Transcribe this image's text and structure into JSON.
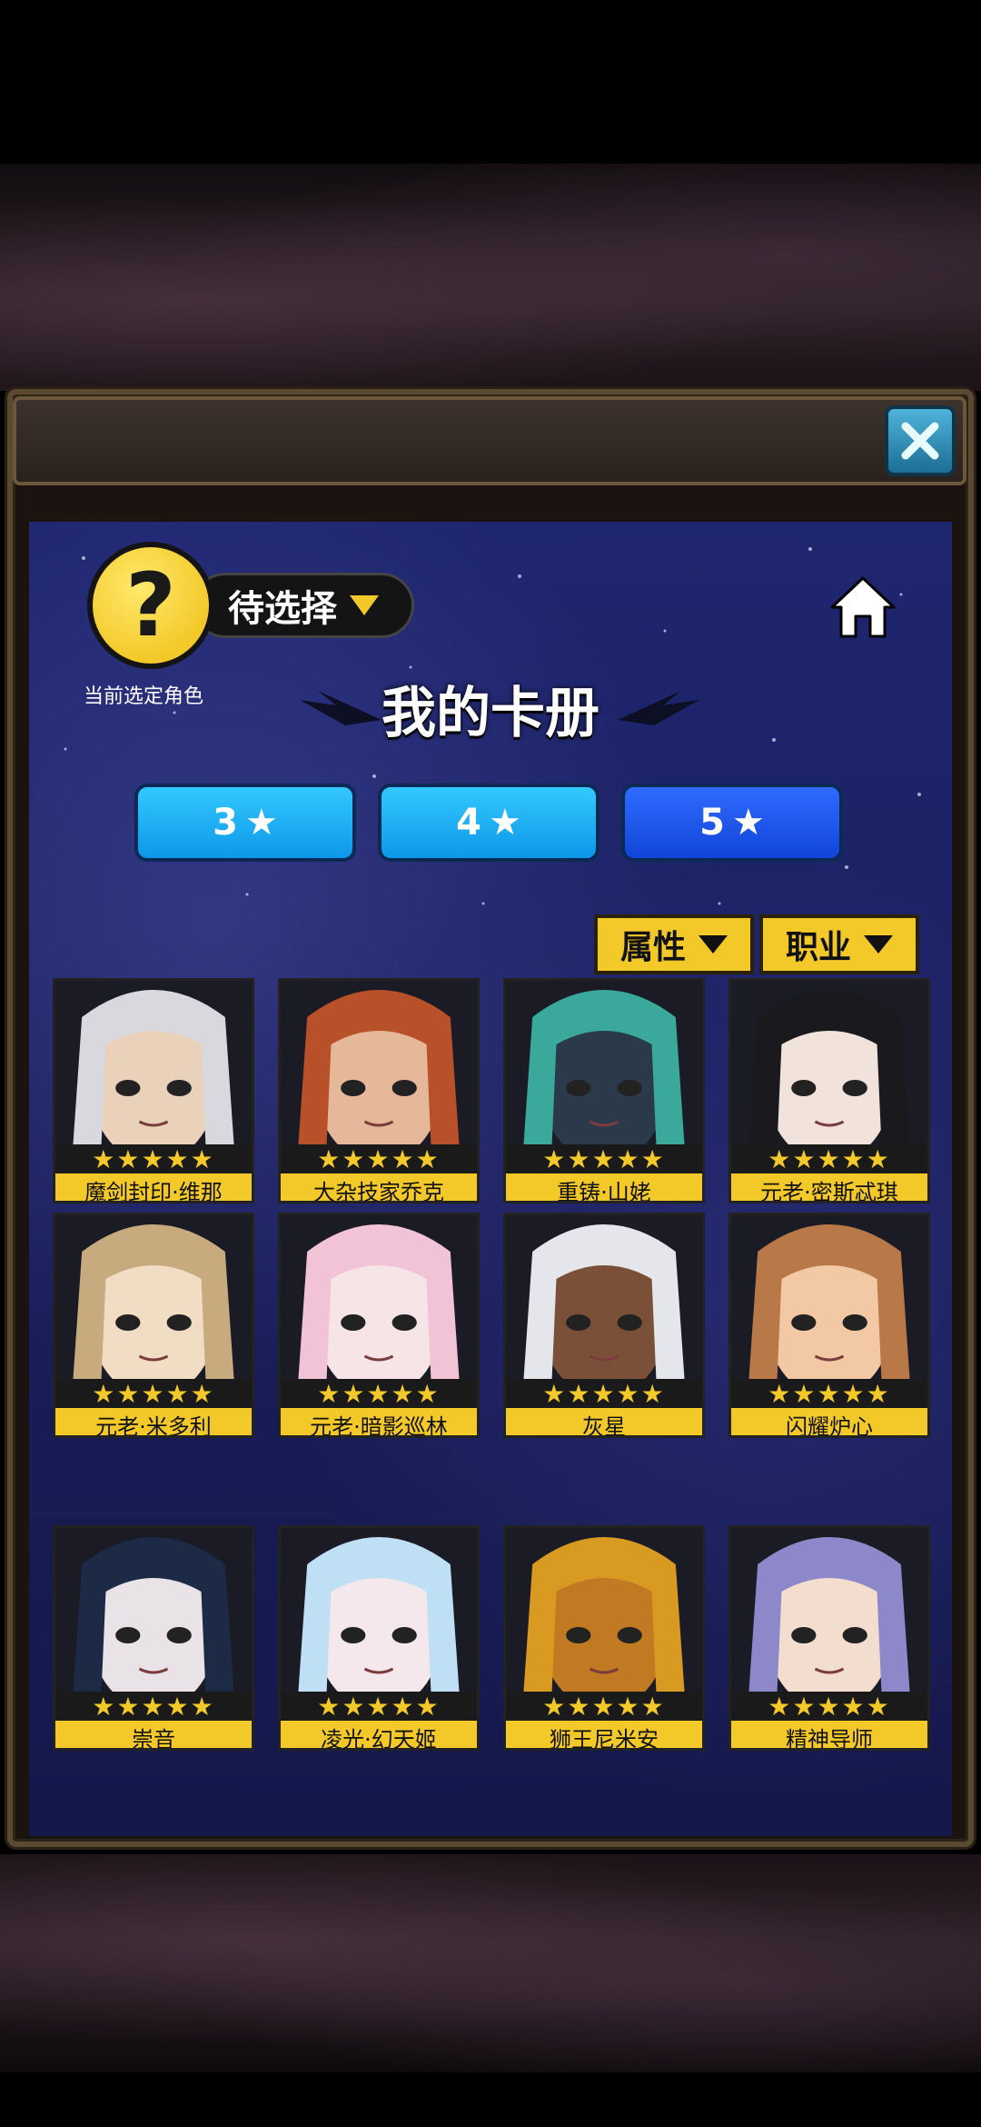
{
  "header": {
    "current_character_icon": "question-mark",
    "current_character_label": "当前选定角色",
    "pending_selector_label": "待选择",
    "page_title": "我的卡册"
  },
  "star_tabs": [
    {
      "label": "3",
      "icon": "star-icon"
    },
    {
      "label": "4",
      "icon": "star-icon"
    },
    {
      "label": "5",
      "icon": "star-icon",
      "selected": true
    }
  ],
  "filters": [
    {
      "label": "属性"
    },
    {
      "label": "职业"
    }
  ],
  "cards": [
    {
      "name": "魔剑封印·维那",
      "stars": "★★★★★",
      "rating": 5,
      "hair": "#d8d8de",
      "skin": "#e9d2b9"
    },
    {
      "name": "大杂技家乔克",
      "stars": "★★★★★",
      "rating": 5,
      "hair": "#b8502a",
      "skin": "#e6b89a"
    },
    {
      "name": "重铸·山姥",
      "stars": "★★★★★",
      "rating": 5,
      "hair": "#3aa89a",
      "skin": "#2b3a4a"
    },
    {
      "name": "元老·密斯忒琪",
      "stars": "★★★★★",
      "rating": 5,
      "hair": "#1a1a1e",
      "skin": "#f1e3dc"
    },
    {
      "name": "元老·米多利",
      "stars": "★★★★★",
      "rating": 5,
      "hair": "#c7aa7e",
      "skin": "#f1dcc4"
    },
    {
      "name": "元老·暗影巡林",
      "stars": "★★★★★",
      "rating": 5,
      "hair": "#f2c3d6",
      "skin": "#f6e4e6"
    },
    {
      "name": "灰星",
      "stars": "★★★★★",
      "rating": 5,
      "hair": "#e4e6ec",
      "skin": "#7a5138"
    },
    {
      "name": "闪耀炉心",
      "stars": "★★★★★",
      "rating": 5,
      "hair": "#b97848",
      "skin": "#f2c9a4"
    },
    {
      "name": "崇音",
      "stars": "★★★★★",
      "rating": 5,
      "hair": "#1d2a46",
      "skin": "#e9e2e6"
    },
    {
      "name": "凌光·幻天姬",
      "stars": "★★★★★",
      "rating": 5,
      "hair": "#bfe0f4",
      "skin": "#f4e8ec"
    },
    {
      "name": "狮王尼米安",
      "stars": "★★★★★",
      "rating": 5,
      "hair": "#d99a22",
      "skin": "#c27a22"
    },
    {
      "name": "精神导师",
      "stars": "★★★★★",
      "rating": 5,
      "hair": "#8d88c9",
      "skin": "#f2ddcf"
    }
  ],
  "colors": {
    "accent_yellow": "#f3c92a",
    "tab_blue": "#1aa8f5",
    "tab_selected": "#1e56e6",
    "close_button": "#3aa0c8"
  }
}
